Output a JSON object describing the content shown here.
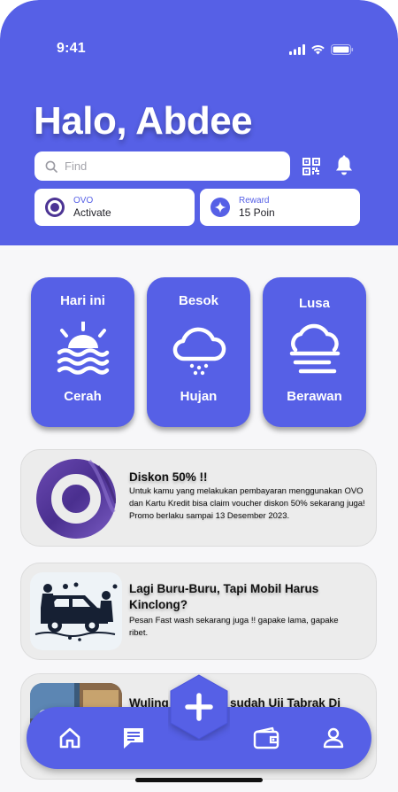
{
  "status_bar": {
    "time": "9:41"
  },
  "header": {
    "greeting": "Halo, Abdee",
    "search_placeholder": "Find",
    "ovo": {
      "label": "OVO",
      "value": "Activate"
    },
    "reward": {
      "label": "Reward",
      "value": "15 Poin"
    }
  },
  "weather": [
    {
      "day": "Hari ini",
      "condition": "Cerah",
      "icon": "sun-waves-icon"
    },
    {
      "day": "Besok",
      "condition": "Hujan",
      "icon": "cloud-rain-icon"
    },
    {
      "day": "Lusa",
      "condition": "Berawan",
      "icon": "cloud-fog-icon"
    }
  ],
  "promos": [
    {
      "title": "Diskon 50% !!",
      "description": "Untuk kamu yang melakukan pembayaran menggunakan OVO dan Kartu Kredit bisa claim voucher diskon 50% sekarang juga! Promo berlaku sampai 13 Desember 2023."
    },
    {
      "title": "Lagi Buru-Buru, Tapi Mobil Harus Kinclong?",
      "description": "Pesan Fast wash sekarang juga !! gapake lama, gapake ribet."
    },
    {
      "title": "Wuling … sudah Uji Tabrak Di",
      "title_left": "Wuling",
      "title_right": "sudah Uji Tabrak Di",
      "description": ""
    }
  ],
  "nav": {
    "items": [
      "home-icon",
      "chat-icon",
      "add-icon",
      "wallet-icon",
      "profile-icon"
    ]
  },
  "colors": {
    "primary": "#5660e6",
    "card_bg": "#ececec"
  }
}
